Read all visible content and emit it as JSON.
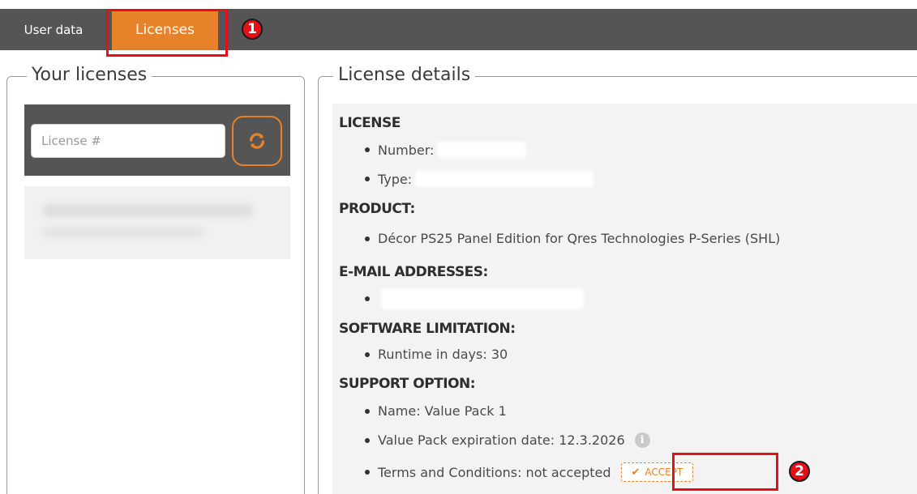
{
  "tabs": {
    "user_data": "User data",
    "licenses": "Licenses"
  },
  "markers": {
    "one": "1",
    "two": "2"
  },
  "left": {
    "legend": "Your licenses",
    "search_placeholder": "License #"
  },
  "right": {
    "legend": "License details",
    "license": {
      "heading": "LICENSE",
      "number_label": "Number:",
      "type_label": "Type:"
    },
    "product": {
      "heading": "PRODUCT:",
      "name": "Décor PS25 Panel Edition for Qres Technologies P-Series (SHL)"
    },
    "emails": {
      "heading": "E-MAIL ADDRESSES:"
    },
    "software": {
      "heading": "SOFTWARE LIMITATION:",
      "runtime": "Runtime in days: 30"
    },
    "support": {
      "heading": "SUPPORT OPTION:",
      "name": "Name: Value Pack 1",
      "expiration": "Value Pack expiration date: 12.3.2026",
      "terms": "Terms and Conditions: not accepted",
      "accept_label": "ACCEPT"
    }
  },
  "colors": {
    "accent": "#e8822a",
    "bar": "#555555",
    "highlight": "#e3101a"
  }
}
